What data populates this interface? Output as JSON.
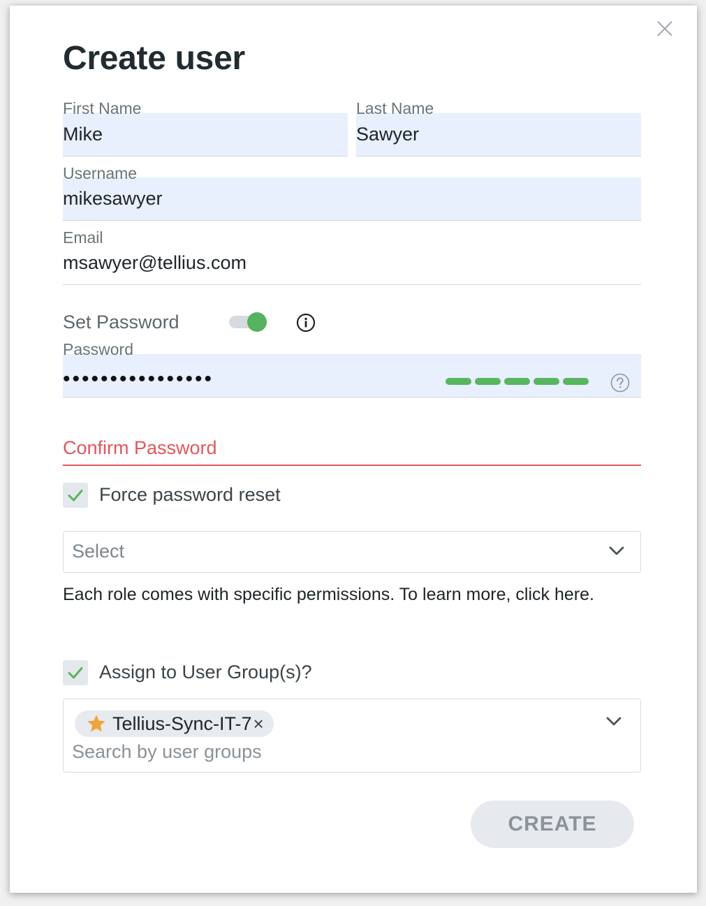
{
  "dialog": {
    "title": "Create user"
  },
  "form": {
    "first_name": {
      "label": "First Name",
      "value": "Mike"
    },
    "last_name": {
      "label": "Last Name",
      "value": "Sawyer"
    },
    "username": {
      "label": "Username",
      "value": "mikesawyer"
    },
    "email": {
      "label": "Email",
      "value": "msawyer@tellius.com"
    },
    "set_password": {
      "label": "Set Password",
      "enabled": true
    },
    "password": {
      "label": "Password",
      "masked_value": "••••••••••••••••",
      "strength_segments": 5
    },
    "confirm_password": {
      "label": "Confirm Password"
    },
    "force_reset": {
      "label": "Force password reset",
      "checked": true
    },
    "role_select": {
      "placeholder": "Select"
    },
    "role_help": "Each role comes with specific permissions. To learn more, click here.",
    "assign_groups": {
      "label": "Assign to User Group(s)?",
      "checked": true
    },
    "groups": {
      "selected": [
        "Tellius-Sync-IT-7"
      ],
      "remove_glyph": "×",
      "search_placeholder": "Search by user groups"
    }
  },
  "actions": {
    "create_label": "CREATE"
  },
  "colors": {
    "accent_green": "#55b25f",
    "error_red": "#e0575b",
    "field_bg": "#e8effd",
    "star": "#f0a43c"
  }
}
